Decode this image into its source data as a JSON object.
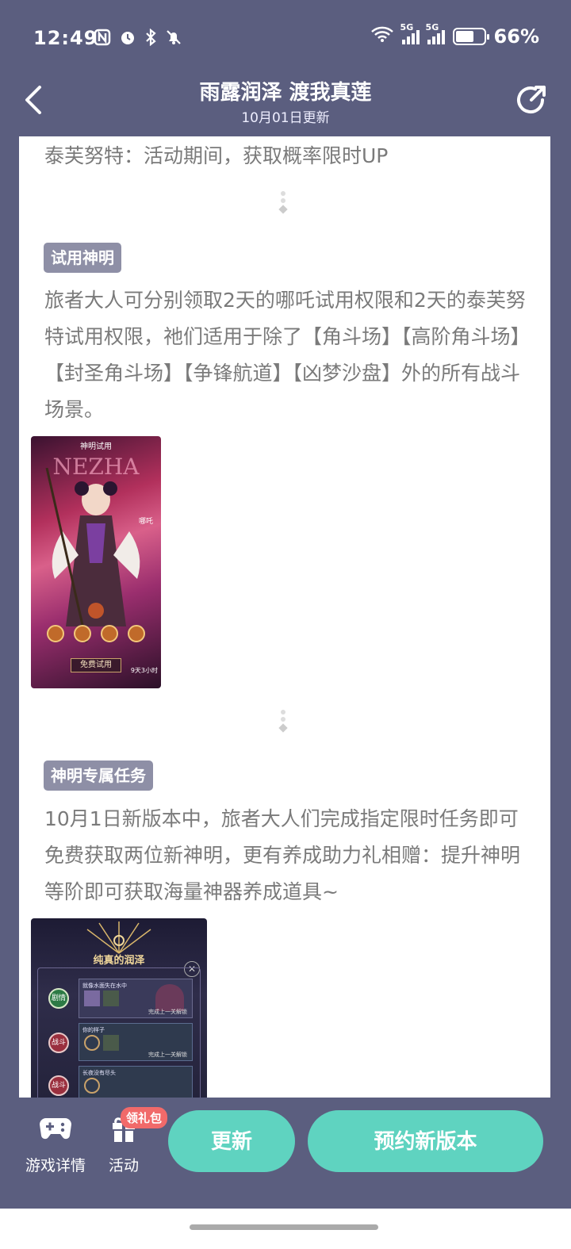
{
  "status_bar": {
    "time": "12:49",
    "network_tag_1": "5G",
    "network_tag_2": "5G",
    "battery": "66%",
    "battery_level": 0.66
  },
  "header": {
    "title": "雨露润泽 渡我真莲",
    "subtitle": "10月01日更新"
  },
  "content": {
    "intro_line": "泰芙努特：活动期间，获取概率限时UP",
    "section1": {
      "label": "试用神明",
      "text": "旅者大人可分别领取2天的哪吒试用权限和2天的泰芙努特试用权限，祂们适用于除了【角斗场】【高阶角斗场】【封圣角斗场】【争锋航道】【凶梦沙盘】外的所有战斗场景。",
      "image_banner": "神明试用",
      "image_name": "NEZHA",
      "image_char": "哪吒",
      "image_button": "免费试用",
      "image_time": "9天3小时"
    },
    "section2": {
      "label": "神明专属任务",
      "text": "10月1日新版本中，旅者大人们完成指定限时任务即可免费获取两位新神明，更有养成助力礼相赠：提升神明等阶即可获取海量神器养成道具~",
      "image_title": "纯真的润泽",
      "rows": [
        {
          "badge": "剧情",
          "title": "就像水面失在水中",
          "status": "完成上一关解锁"
        },
        {
          "badge": "战斗",
          "title": "你的样子",
          "status": "完成上一关解锁"
        },
        {
          "badge": "战斗",
          "title": "长夜没有尽头",
          "status": ""
        }
      ]
    }
  },
  "bottom": {
    "game_details": "游戏详情",
    "activity": "活动",
    "gift_badge": "领礼包",
    "update_button": "更新",
    "reserve_button": "预约新版本"
  },
  "colors": {
    "background": "#5b5e7f",
    "accent": "#5fd3c0",
    "tag": "#8e8fa6",
    "badge": "#f16a6a"
  }
}
